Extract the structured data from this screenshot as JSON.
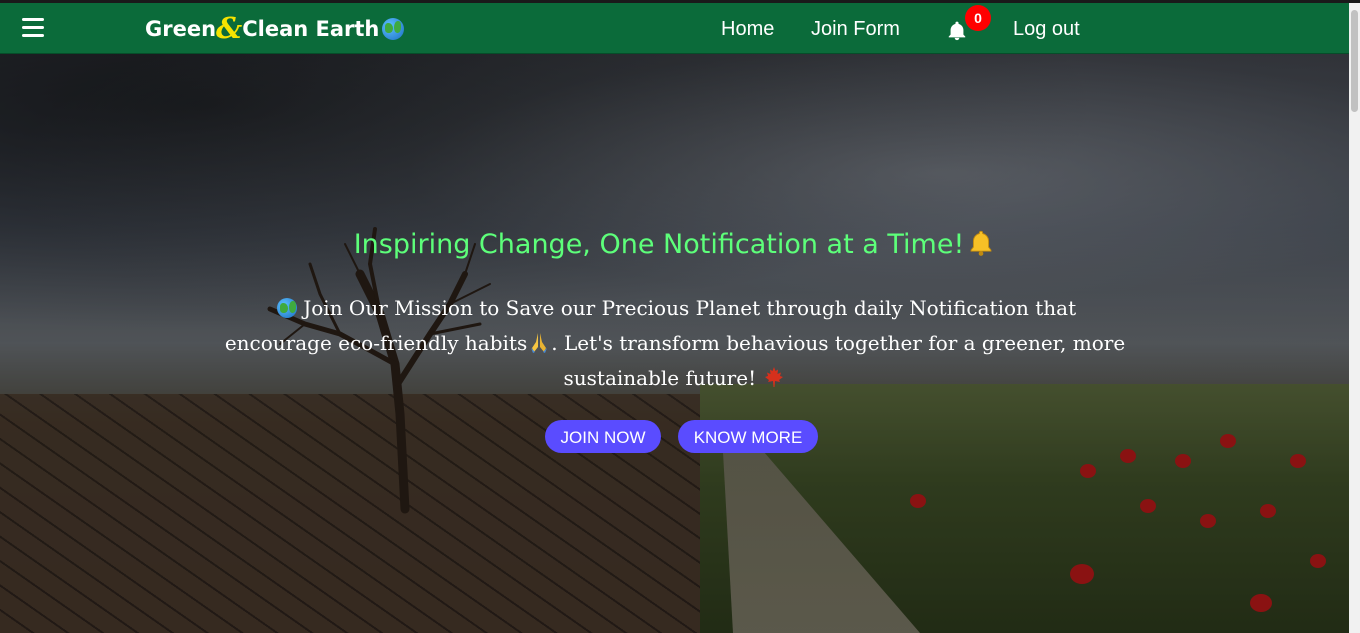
{
  "navbar": {
    "brand_part1": "Green",
    "brand_amp": "&",
    "brand_part2": "Clean Earth",
    "links": {
      "home": "Home",
      "join_form": "Join Form",
      "logout": "Log out"
    },
    "notification_count": "0",
    "color": "#0b6b3a"
  },
  "hero": {
    "headline": "Inspiring Change, One Notification at a Time!",
    "description_part1": " Join Our Mission to Save our Precious Planet through daily Notification that encourage eco-friendly habits",
    "description_part2": ". Let's transform behavious together for a greener, more sustainable future! ",
    "buttons": {
      "join": "JOIN NOW",
      "know_more": "KNOW MORE"
    },
    "headline_color": "#5dff7a",
    "button_color": "#5a4cff"
  },
  "icons": [
    "menu-icon",
    "globe-icon",
    "bell-icon",
    "prayer-hands-icon",
    "maple-leaf-icon"
  ]
}
